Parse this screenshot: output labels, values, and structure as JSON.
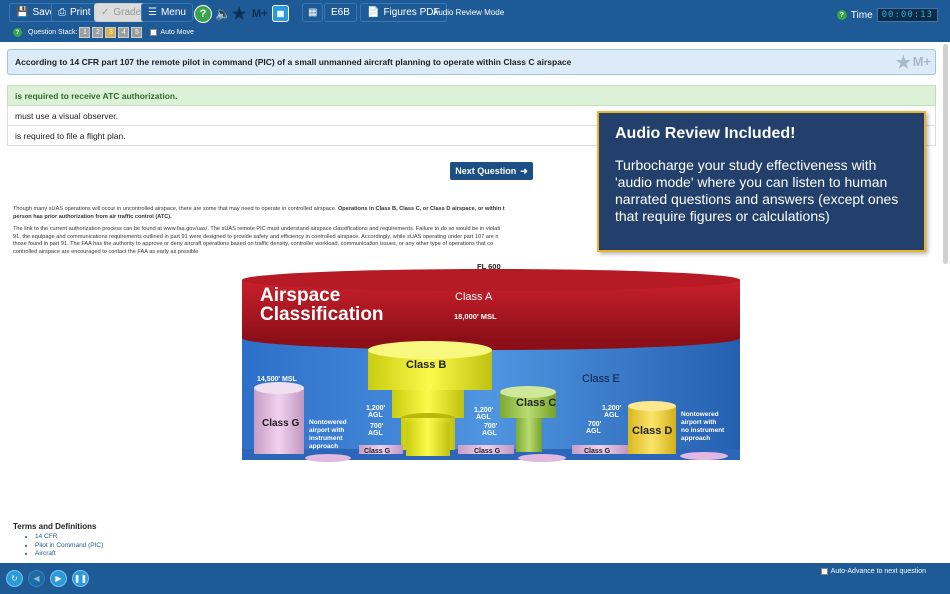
{
  "toolbar": {
    "save_label": "Save",
    "print_label": "Print",
    "grade_label": "Grade",
    "menu_label": "Menu",
    "help_icon": "question-icon",
    "mplus_label": "M+",
    "e6b_label": "E6B",
    "figures_label": "Figures PDF",
    "mode_label": "Audio Review Mode",
    "time_label": "Time",
    "timer_value": "00:00:13",
    "question_stack_label": "Question Stack:",
    "stack_numbers": [
      "1",
      "2",
      "3",
      "4",
      "5"
    ],
    "auto_move_label": "Auto Move"
  },
  "question": {
    "text": "According to 14 CFR part 107 the remote pilot in command (PIC) of a small unmanned aircraft planning to operate within Class C airspace",
    "mplus": "M+",
    "answers": [
      "is required to receive ATC authorization.",
      "must use a visual observer.",
      "is required to file a flight plan."
    ]
  },
  "next_button_label": "Next Question",
  "explanation": {
    "p1_normal": "Though many sUAS operations will occur in uncontrolled airspace, there are some that may need to operate in controlled airspace. ",
    "p1_bold": "Operations in Class B, Class C, or Class D airspace, or within t",
    "p1_bold2": "person has prior authorization from air traffic control (ATC).",
    "p2_line1": "The link to the current authorization process can be found at www.faa.gov/uas/. The sUAS remote PIC must understand airspace classifications and requirements. Failure to do so would be in violati",
    "p2_line2": "91, the equipage and communications requirements outlined in part 91 were designed to provide safety and efficiency in controlled airspace. Accordingly, while sUAS operating under part 107 are n",
    "p2_line3": "those found in part 91. The FAA has the authority to approve or deny aircraft operations based on traffic density, controller workload, communication issues, or any other type of operations that co",
    "p2_line4": "controlled airspace are encouraged to contact the FAA as early as possible"
  },
  "figure": {
    "fl_label": "FL 600",
    "title_line1": "Airspace",
    "title_line2": "Classification",
    "class_a": "Class A",
    "class_a_alt": "18,000' MSL",
    "class_b": "Class B",
    "class_c": "Class C",
    "class_d": "Class D",
    "class_e": "Class E",
    "class_g": "Class G",
    "msl_14500": "14,500' MSL",
    "agl_1200": "1,200'",
    "agl_700": "700'",
    "agl": "AGL",
    "nontowered_left": [
      "Nontowered",
      "airport with",
      "instrument",
      "approach"
    ],
    "nontowered_right": [
      "Nontowered",
      "airport with",
      "no instrument",
      "approach"
    ],
    "class_g_small": "Class G"
  },
  "popup": {
    "title": "Audio Review Included!",
    "body": "Turbocharge your study effectiveness with 'audio mode' where you can listen to human narrated  questions and answers (except ones that require figures or calculations)"
  },
  "terms": {
    "heading": "Terms and Definitions",
    "items": [
      "14 CFR",
      "Pilot in Command (PIC)",
      "Aircraft"
    ]
  },
  "bottom": {
    "auto_advance_label": "Auto-Advance to next question"
  },
  "colors": {
    "bar": "#1d5a96",
    "popup_bg": "#233f6c",
    "popup_border": "#e6b32a"
  }
}
